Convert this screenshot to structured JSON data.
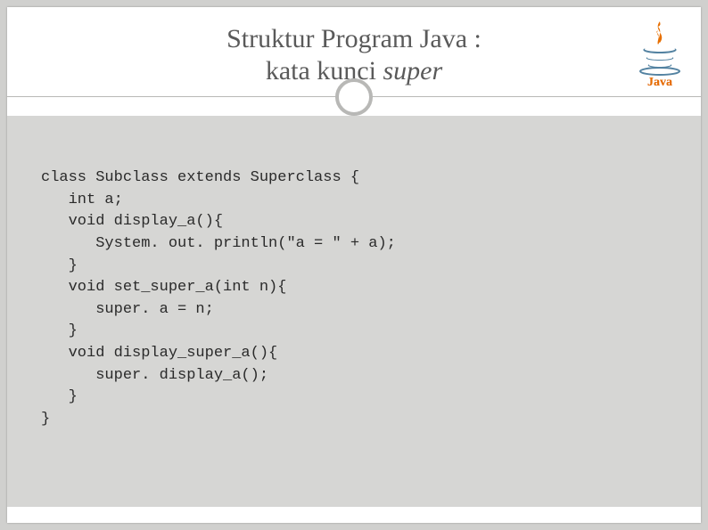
{
  "title": {
    "line1": "Struktur Program Java :",
    "line2_prefix": "kata kunci ",
    "line2_italic": "super"
  },
  "logo": {
    "name": "java-logo",
    "text": "Java"
  },
  "code": {
    "l1": "class Subclass extends Superclass {",
    "l2": "   int a;",
    "l3": "   void display_a(){",
    "l4": "      System. out. println(\"a = \" + a);",
    "l5": "   }",
    "l6": "   void set_super_a(int n){",
    "l7": "      super. a = n;",
    "l8": "   }",
    "l9": "   void display_super_a(){",
    "l10": "      super. display_a();",
    "l11": "   }",
    "l12": "}"
  }
}
